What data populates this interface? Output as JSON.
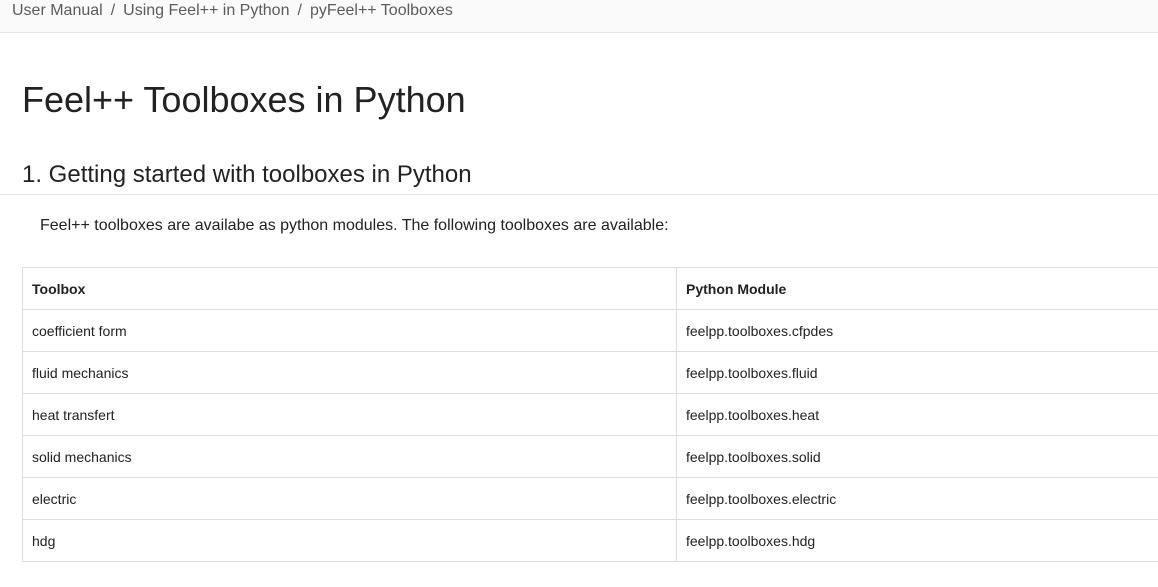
{
  "breadcrumb": {
    "items": [
      "User Manual",
      "Using Feel++ in Python",
      "pyFeel++ Toolboxes"
    ],
    "separator": "/"
  },
  "page": {
    "title": "Feel++ Toolboxes in Python",
    "section_title": "1. Getting started with toolboxes in Python",
    "intro": "Feel++ toolboxes are availabe as python modules. The following toolboxes are available:"
  },
  "table": {
    "headers": [
      "Toolbox",
      "Python Module"
    ],
    "rows": [
      [
        "coefficient form",
        "feelpp.toolboxes.cfpdes"
      ],
      [
        "fluid mechanics",
        "feelpp.toolboxes.fluid"
      ],
      [
        "heat transfert",
        "feelpp.toolboxes.heat"
      ],
      [
        "solid mechanics",
        "feelpp.toolboxes.solid"
      ],
      [
        "electric",
        "feelpp.toolboxes.electric"
      ],
      [
        "hdg",
        "feelpp.toolboxes.hdg"
      ]
    ]
  }
}
